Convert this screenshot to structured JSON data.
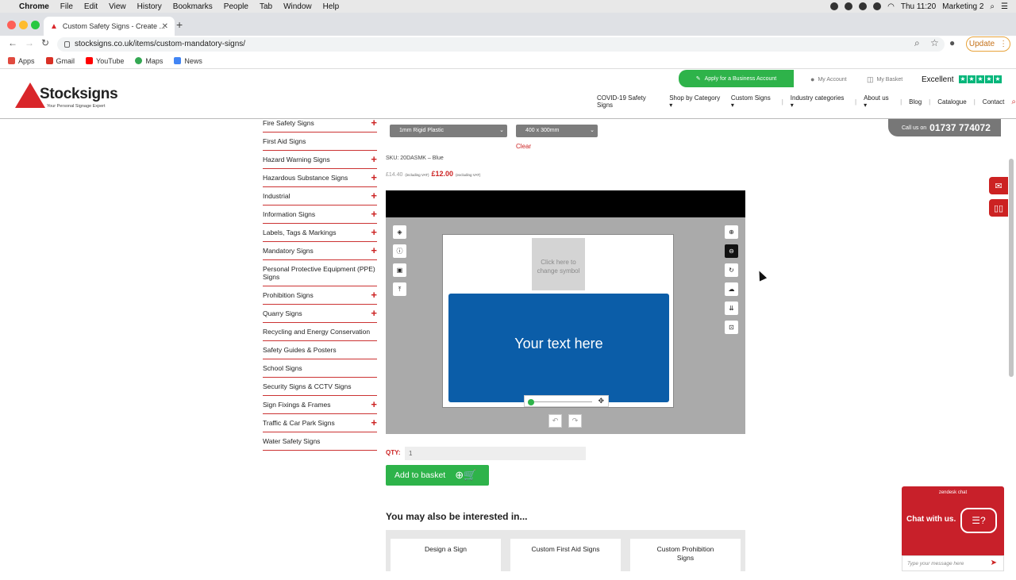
{
  "macos": {
    "menu": [
      "Chrome",
      "File",
      "Edit",
      "View",
      "History",
      "Bookmarks",
      "People",
      "Tab",
      "Window",
      "Help"
    ],
    "clock": "Thu 11:20",
    "user": "Marketing 2"
  },
  "browser": {
    "tab_title": "Custom Safety Signs - Create ...",
    "url": "stocksigns.co.uk/items/custom-mandatory-signs/",
    "update_label": "Update",
    "bookmarks": [
      {
        "label": "Apps",
        "color": "#e04a3f"
      },
      {
        "label": "Gmail",
        "color": "#d93025"
      },
      {
        "label": "YouTube",
        "color": "#ff0000"
      },
      {
        "label": "Maps",
        "color": "#34a853"
      },
      {
        "label": "News",
        "color": "#4285f4"
      }
    ]
  },
  "header": {
    "logo_name": "Stocksigns",
    "logo_tagline": "Your Personal Signage Expert",
    "business_btn": "Apply for a Business Account",
    "my_account": "My Account",
    "my_basket": "My Basket",
    "trust_label": "Excellent",
    "nav": [
      {
        "label": "COVID-19 Safety Signs",
        "caret": false
      },
      {
        "label": "Shop by Category",
        "caret": true
      },
      {
        "label": "Custom Signs",
        "caret": true
      },
      {
        "label": "Industry categories",
        "caret": true
      },
      {
        "label": "About us",
        "caret": true
      },
      {
        "label": "Blog",
        "caret": false
      },
      {
        "label": "Catalogue",
        "caret": false
      },
      {
        "label": "Contact",
        "caret": false
      }
    ],
    "call_label": "Call us on",
    "phone": "01737 774072"
  },
  "sidebar": {
    "items": [
      {
        "label": "Fire Safety Signs",
        "expand": true
      },
      {
        "label": "First Aid Signs",
        "expand": false
      },
      {
        "label": "Hazard Warning Signs",
        "expand": true
      },
      {
        "label": "Hazardous Substance Signs",
        "expand": true
      },
      {
        "label": "Industrial",
        "expand": true
      },
      {
        "label": "Information Signs",
        "expand": true
      },
      {
        "label": "Labels, Tags & Markings",
        "expand": true
      },
      {
        "label": "Mandatory Signs",
        "expand": true
      },
      {
        "label": "Personal Protective Equipment (PPE) Signs",
        "expand": false
      },
      {
        "label": "Prohibition Signs",
        "expand": true
      },
      {
        "label": "Quarry Signs",
        "expand": true
      },
      {
        "label": "Recycling and Energy Conservation",
        "expand": false
      },
      {
        "label": "Safety Guides & Posters",
        "expand": false
      },
      {
        "label": "School Signs",
        "expand": false
      },
      {
        "label": "Security Signs & CCTV Signs",
        "expand": false
      },
      {
        "label": "Sign Fixings & Frames",
        "expand": true
      },
      {
        "label": "Traffic & Car Park Signs",
        "expand": true
      },
      {
        "label": "Water Safety Signs",
        "expand": false
      }
    ]
  },
  "product": {
    "material": "1mm Rigid Plastic",
    "size": "400 x 300mm",
    "clear": "Clear",
    "sku": "SKU: 20DASMK – Blue",
    "price_inc": "£14.40",
    "price_inc_note": "(including VAT)",
    "price_ex": "£12.00",
    "price_ex_note": "(excluding VAT)"
  },
  "designer": {
    "symbol_placeholder": "Click here to change symbol",
    "sign_text": "Your text here",
    "sign_color": "#0b5da8"
  },
  "purchase": {
    "qty_label": "QTY:",
    "qty_value": "1",
    "add_label": "Add to basket"
  },
  "related": {
    "heading": "You may also be interested in...",
    "cards": [
      "Design a Sign",
      "Custom First Aid Signs",
      "Custom Prohibition Signs"
    ]
  },
  "chat": {
    "title": "zendesk chat",
    "message": "Chat with us.",
    "placeholder": "Type your message here"
  },
  "colors": {
    "brand_red": "#d9262a",
    "brand_green": "#2eb34a",
    "trustpilot": "#00b67a"
  }
}
